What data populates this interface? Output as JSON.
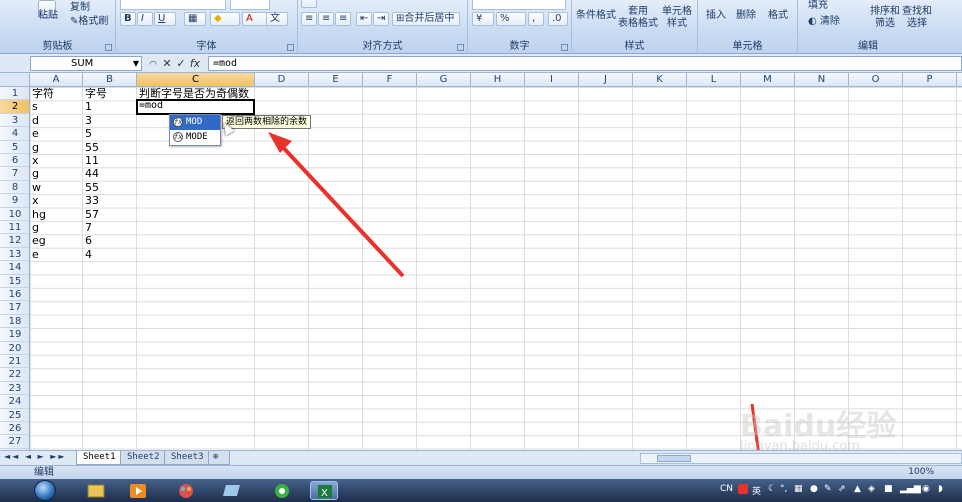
{
  "ribbon": {
    "clipboard": {
      "paste": "粘贴",
      "copy": "复制",
      "format_painter": "格式刷",
      "title": "剪贴板"
    },
    "font": {
      "title": "字体",
      "bold": "B",
      "italic": "I",
      "underline": "U"
    },
    "alignment": {
      "title": "对齐方式",
      "merge": "合并后居中"
    },
    "number": {
      "title": "数字",
      "percent": "%"
    },
    "styles": {
      "title": "样式",
      "conditional": "条件格式",
      "table": "套用\n表格格式",
      "cell_styles": "单元格\n样式"
    },
    "cells": {
      "title": "单元格",
      "insert": "插入",
      "delete": "删除",
      "format": "格式"
    },
    "editing": {
      "title": "编辑",
      "fill": "填充",
      "clear": "清除",
      "sort": "排序和\n筛选",
      "find": "查找和\n选择"
    }
  },
  "formula_bar": {
    "name_box": "SUM",
    "formula": "=mod"
  },
  "columns": [
    "A",
    "B",
    "C",
    "D",
    "E",
    "F",
    "G",
    "H",
    "I",
    "J",
    "K",
    "L",
    "M",
    "N",
    "O",
    "P"
  ],
  "rows": [
    "1",
    "2",
    "3",
    "4",
    "5",
    "6",
    "7",
    "8",
    "9",
    "10",
    "11",
    "12",
    "13",
    "14",
    "15",
    "16",
    "17",
    "18",
    "19",
    "20",
    "21",
    "22",
    "23",
    "24",
    "25",
    "26",
    "27"
  ],
  "cells": {
    "A1": "字符",
    "B1": "字号",
    "C1": "判断字号是否为奇偶数",
    "A2": "s",
    "B2": "1",
    "A3": "d",
    "B3": "3",
    "A4": "e",
    "B4": "5",
    "A5": "g",
    "B5": "55",
    "A6": "x",
    "B6": "11",
    "A7": "g",
    "B7": "44",
    "A8": "w",
    "B8": "55",
    "A9": "x",
    "B9": "33",
    "A10": "hg",
    "B10": "57",
    "A11": "g",
    "B11": "7",
    "A12": "eg",
    "B12": "6",
    "A13": "e",
    "B13": "4",
    "C2": "=mod"
  },
  "autocomplete": {
    "items": [
      {
        "label": "MOD"
      },
      {
        "label": "MODE"
      }
    ],
    "tooltip": "返回两数相除的余数"
  },
  "sheets": [
    "Sheet1",
    "Sheet2",
    "Sheet3"
  ],
  "status": {
    "mode": "编辑",
    "zoom": "100%"
  },
  "tray": {
    "lang": "CN",
    "ime": "英"
  },
  "watermark": {
    "logo": "Baidu经验",
    "url": "jingyan.baidu.com"
  }
}
